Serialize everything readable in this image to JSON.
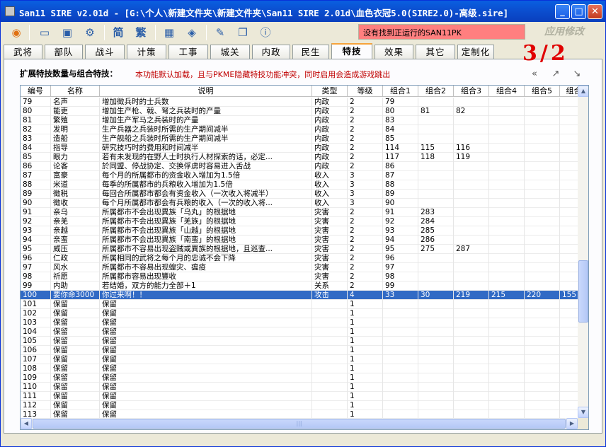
{
  "window": {
    "title": "San11 SIRE v2.01d - [G:\\个人\\新建文件夹\\新建文件夹\\San11 SIRE 2.01d\\血色衣冠5.0(SIRE2.0)-高级.sire]",
    "min_glyph": "_",
    "max_glyph": "□",
    "close_glyph": "✕"
  },
  "toolbar": {
    "traditional_char_left": "简",
    "traditional_char_right": "繁",
    "status_message": "没有找到正运行的SAN11PK",
    "apply_label": "应用修改"
  },
  "tabs": [
    "武将",
    "部队",
    "战斗",
    "计策",
    "工事",
    "城关",
    "内政",
    "民生",
    "特技",
    "效果",
    "其它",
    "定制化"
  ],
  "active_tab": "特技",
  "panel": {
    "title": "扩展特技数量与组合特技：",
    "note": "本功能默认加载，且与PKME隐藏特技功能冲突，同时启用会造成游戏跳出",
    "handwritten": "3/2"
  },
  "grid": {
    "columns": [
      "编号",
      "名称",
      "说明",
      "类型",
      "等级",
      "组合1",
      "组合2",
      "组合3",
      "组合4",
      "组合5",
      "组合"
    ],
    "rows": [
      [
        "79",
        "名声",
        "增加徵兵时的士兵数",
        "内政",
        "2",
        "79",
        "",
        "",
        "",
        "",
        ""
      ],
      [
        "80",
        "能吏",
        "增加生产枪、戟、弩之兵装时的产量",
        "内政",
        "2",
        "80",
        "81",
        "82",
        "",
        "",
        ""
      ],
      [
        "81",
        "繁殖",
        "增加生产军马之兵装时的产量",
        "内政",
        "2",
        "83",
        "",
        "",
        "",
        "",
        ""
      ],
      [
        "82",
        "发明",
        "生产兵器之兵装时所需的生产期间减半",
        "内政",
        "2",
        "84",
        "",
        "",
        "",
        "",
        ""
      ],
      [
        "83",
        "造船",
        "生产舰船之兵装时所需的生产期间减半",
        "内政",
        "2",
        "85",
        "",
        "",
        "",
        "",
        ""
      ],
      [
        "84",
        "指导",
        "研究技巧时的费用和时间减半",
        "内政",
        "2",
        "114",
        "115",
        "116",
        "",
        "",
        ""
      ],
      [
        "85",
        "眼力",
        "若有未发现的在野人士时执行人材探索的话，必定...",
        "内政",
        "2",
        "117",
        "118",
        "119",
        "",
        "",
        ""
      ],
      [
        "86",
        "论客",
        "於同盟、停战协定、交换俘虏时容易进入舌战",
        "内政",
        "2",
        "86",
        "",
        "",
        "",
        "",
        ""
      ],
      [
        "87",
        "富豪",
        "每个月的所属都市的资金收入增加为1.5倍",
        "收入",
        "3",
        "87",
        "",
        "",
        "",
        "",
        ""
      ],
      [
        "88",
        "米道",
        "每季的所属都市的兵粮收入增加为1.5倍",
        "收入",
        "3",
        "88",
        "",
        "",
        "",
        "",
        ""
      ],
      [
        "89",
        "徵税",
        "每回合所属都市都会有资金收入（一次收入将减半）",
        "收入",
        "3",
        "89",
        "",
        "",
        "",
        "",
        ""
      ],
      [
        "90",
        "徵收",
        "每个月所属都市都会有兵粮的收入（一次的收入将...",
        "收入",
        "3",
        "90",
        "",
        "",
        "",
        "",
        ""
      ],
      [
        "91",
        "亲乌",
        "所属都市不会出现異族「乌丸」的根据地",
        "灾害",
        "2",
        "91",
        "283",
        "",
        "",
        "",
        ""
      ],
      [
        "92",
        "亲羌",
        "所属都市不会出现異族「羌族」的根据地",
        "灾害",
        "2",
        "92",
        "284",
        "",
        "",
        "",
        ""
      ],
      [
        "93",
        "亲越",
        "所属都市不会出现異族「山越」的根据地",
        "灾害",
        "2",
        "93",
        "285",
        "",
        "",
        "",
        ""
      ],
      [
        "94",
        "亲蛮",
        "所属都市不会出现異族「南蛮」的根据地",
        "灾害",
        "2",
        "94",
        "286",
        "",
        "",
        "",
        ""
      ],
      [
        "95",
        "威压",
        "所属都市不容易出现盗贼或異族的根据地，且巡查...",
        "灾害",
        "2",
        "95",
        "275",
        "287",
        "",
        "",
        ""
      ],
      [
        "96",
        "仁政",
        "所属相同的武将之每个月的忠诚不会下降",
        "灾害",
        "2",
        "96",
        "",
        "",
        "",
        "",
        ""
      ],
      [
        "97",
        "风水",
        "所属都市不容易出现蝗灾、瘟疫",
        "灾害",
        "2",
        "97",
        "",
        "",
        "",
        "",
        ""
      ],
      [
        "98",
        "祈愿",
        "所属都市容易出现豐收",
        "灾害",
        "2",
        "98",
        "",
        "",
        "",
        "",
        ""
      ],
      [
        "99",
        "内助",
        "若结婚，双方的能力全部＋1",
        "关系",
        "2",
        "99",
        "",
        "",
        "",
        "",
        ""
      ],
      [
        "100",
        "要你命3000",
        "你过来啊！！",
        "攻击",
        "4",
        "33",
        "30",
        "219",
        "215",
        "220",
        "155"
      ],
      [
        "101",
        "保留",
        "保留",
        "",
        "1",
        "",
        "",
        "",
        "",
        "",
        ""
      ],
      [
        "102",
        "保留",
        "保留",
        "",
        "1",
        "",
        "",
        "",
        "",
        "",
        ""
      ],
      [
        "103",
        "保留",
        "保留",
        "",
        "1",
        "",
        "",
        "",
        "",
        "",
        ""
      ],
      [
        "104",
        "保留",
        "保留",
        "",
        "1",
        "",
        "",
        "",
        "",
        "",
        ""
      ],
      [
        "105",
        "保留",
        "保留",
        "",
        "1",
        "",
        "",
        "",
        "",
        "",
        ""
      ],
      [
        "106",
        "保留",
        "保留",
        "",
        "1",
        "",
        "",
        "",
        "",
        "",
        ""
      ],
      [
        "107",
        "保留",
        "保留",
        "",
        "1",
        "",
        "",
        "",
        "",
        "",
        ""
      ],
      [
        "108",
        "保留",
        "保留",
        "",
        "1",
        "",
        "",
        "",
        "",
        "",
        ""
      ],
      [
        "109",
        "保留",
        "保留",
        "",
        "1",
        "",
        "",
        "",
        "",
        "",
        ""
      ],
      [
        "110",
        "保留",
        "保留",
        "",
        "1",
        "",
        "",
        "",
        "",
        "",
        ""
      ],
      [
        "111",
        "保留",
        "保留",
        "",
        "1",
        "",
        "",
        "",
        "",
        "",
        ""
      ],
      [
        "112",
        "保留",
        "保留",
        "",
        "1",
        "",
        "",
        "",
        "",
        "",
        ""
      ],
      [
        "113",
        "保留",
        "保留",
        "",
        "1",
        "",
        "",
        "",
        "",
        "",
        ""
      ]
    ],
    "selected_row_id": "100"
  }
}
